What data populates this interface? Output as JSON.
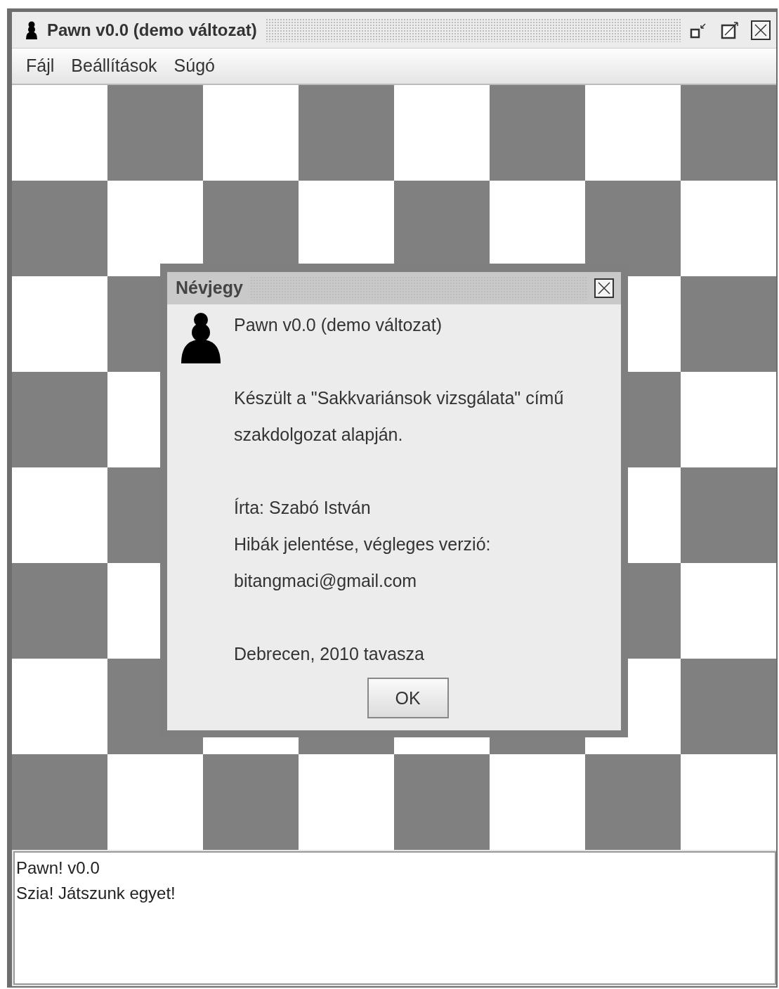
{
  "window": {
    "title": "Pawn v0.0 (demo változat)",
    "controls": [
      {
        "kind": "minimize"
      },
      {
        "kind": "maximize"
      },
      {
        "kind": "close"
      }
    ]
  },
  "menu": [
    {
      "label": "Fájl"
    },
    {
      "label": "Beállítások"
    },
    {
      "label": "Súgó"
    }
  ],
  "log": [
    "Pawn! v0.0",
    "Szia! Játszunk egyet!"
  ],
  "dialog": {
    "title": "Névjegy",
    "paragraphs": [
      [
        "Pawn v0.0 (demo változat)"
      ],
      [
        "Készült a \"Sakkvariánsok vizsgálata\" című",
        "szakdolgozat alapján."
      ],
      [
        "Írta: Szabó István",
        "Hibák jelentése, végleges verzió:",
        "bitangmaci@gmail.com"
      ],
      [
        "Debrecen, 2010 tavasza"
      ]
    ],
    "button": "OK"
  }
}
